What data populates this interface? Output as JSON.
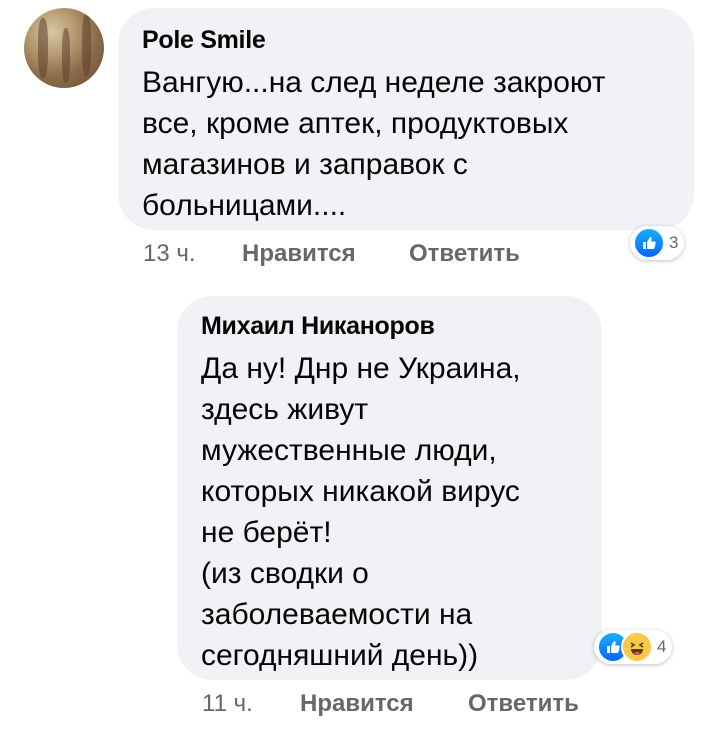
{
  "comments": [
    {
      "author": "Pole Smile",
      "text": "Вангую...на след неделе закроют\nвсе, кроме аптек, продуктовых\nмагазинов и заправок с\nбольницами....",
      "time": "13 ч.",
      "like_label": "Нравится",
      "reply_label": "Ответить",
      "reaction_icons": [
        "like-icon"
      ],
      "reaction_count": "3"
    },
    {
      "author": "Михаил Никаноров",
      "text": "Да ну! Днр не Украина,\nздесь живут\nмужественные люди,\nкоторых никакой вирус\nне берёт!\n(из сводки о\nзаболеваемости на\nсегодняшний день))",
      "time": "11 ч.",
      "like_label": "Нравится",
      "reply_label": "Ответить",
      "reaction_icons": [
        "like-icon",
        "haha-icon"
      ],
      "reaction_count": "4"
    }
  ],
  "colors": {
    "bubble": "#f0f2f5",
    "text": "#050505",
    "secondary": "#65676b",
    "like_blue": "#0866ff",
    "haha_yellow": "#f7c948"
  }
}
